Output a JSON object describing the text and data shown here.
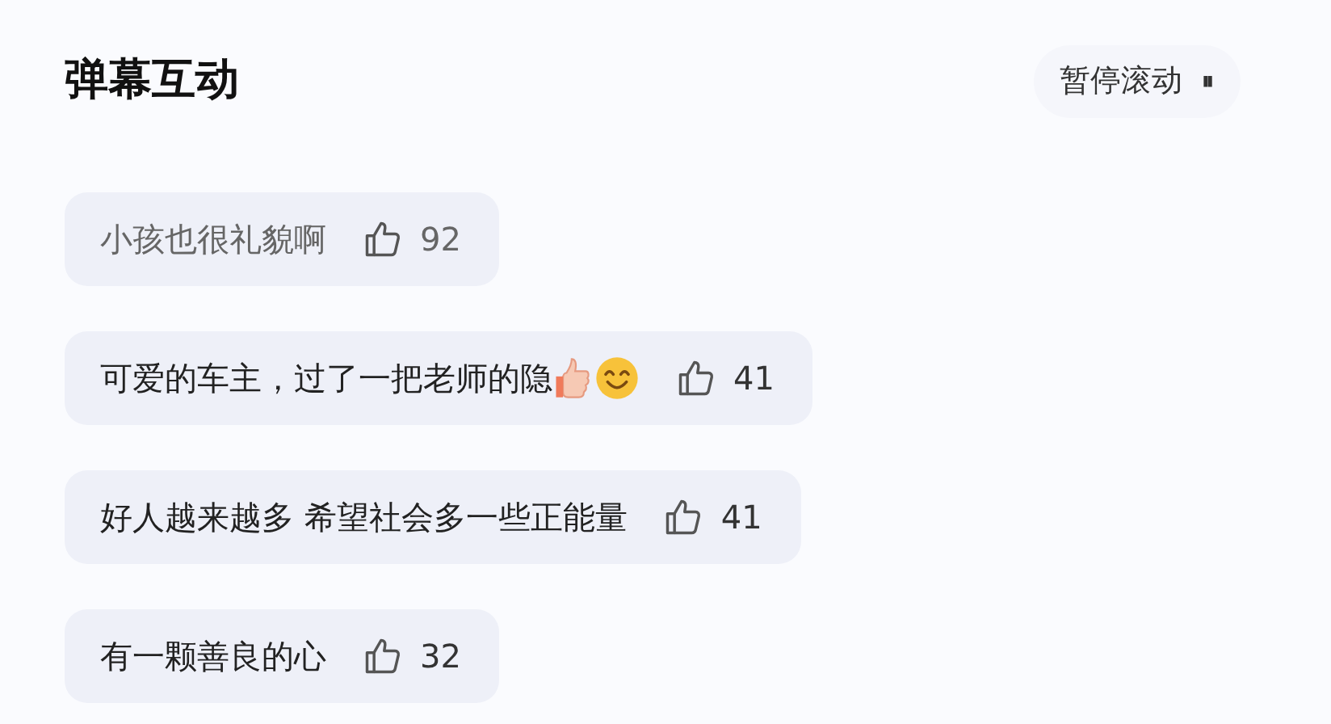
{
  "title": "弹幕互动",
  "pause_button": {
    "label": "暂停滚动",
    "icon": "⏸"
  },
  "comments": [
    {
      "text": "小孩也很礼貌啊",
      "likes": "92",
      "dimmed": true
    },
    {
      "text": "可爱的车主，过了一把老师的隐",
      "likes": "41",
      "dimmed": false,
      "emojis": [
        {
          "kind": "thumbs-up"
        },
        {
          "kind": "smile"
        }
      ]
    },
    {
      "text": "好人越来越多 希望社会多一些正能量",
      "likes": "41",
      "dimmed": false
    },
    {
      "text": "有一颗善良的心",
      "likes": "32",
      "dimmed": false
    }
  ]
}
